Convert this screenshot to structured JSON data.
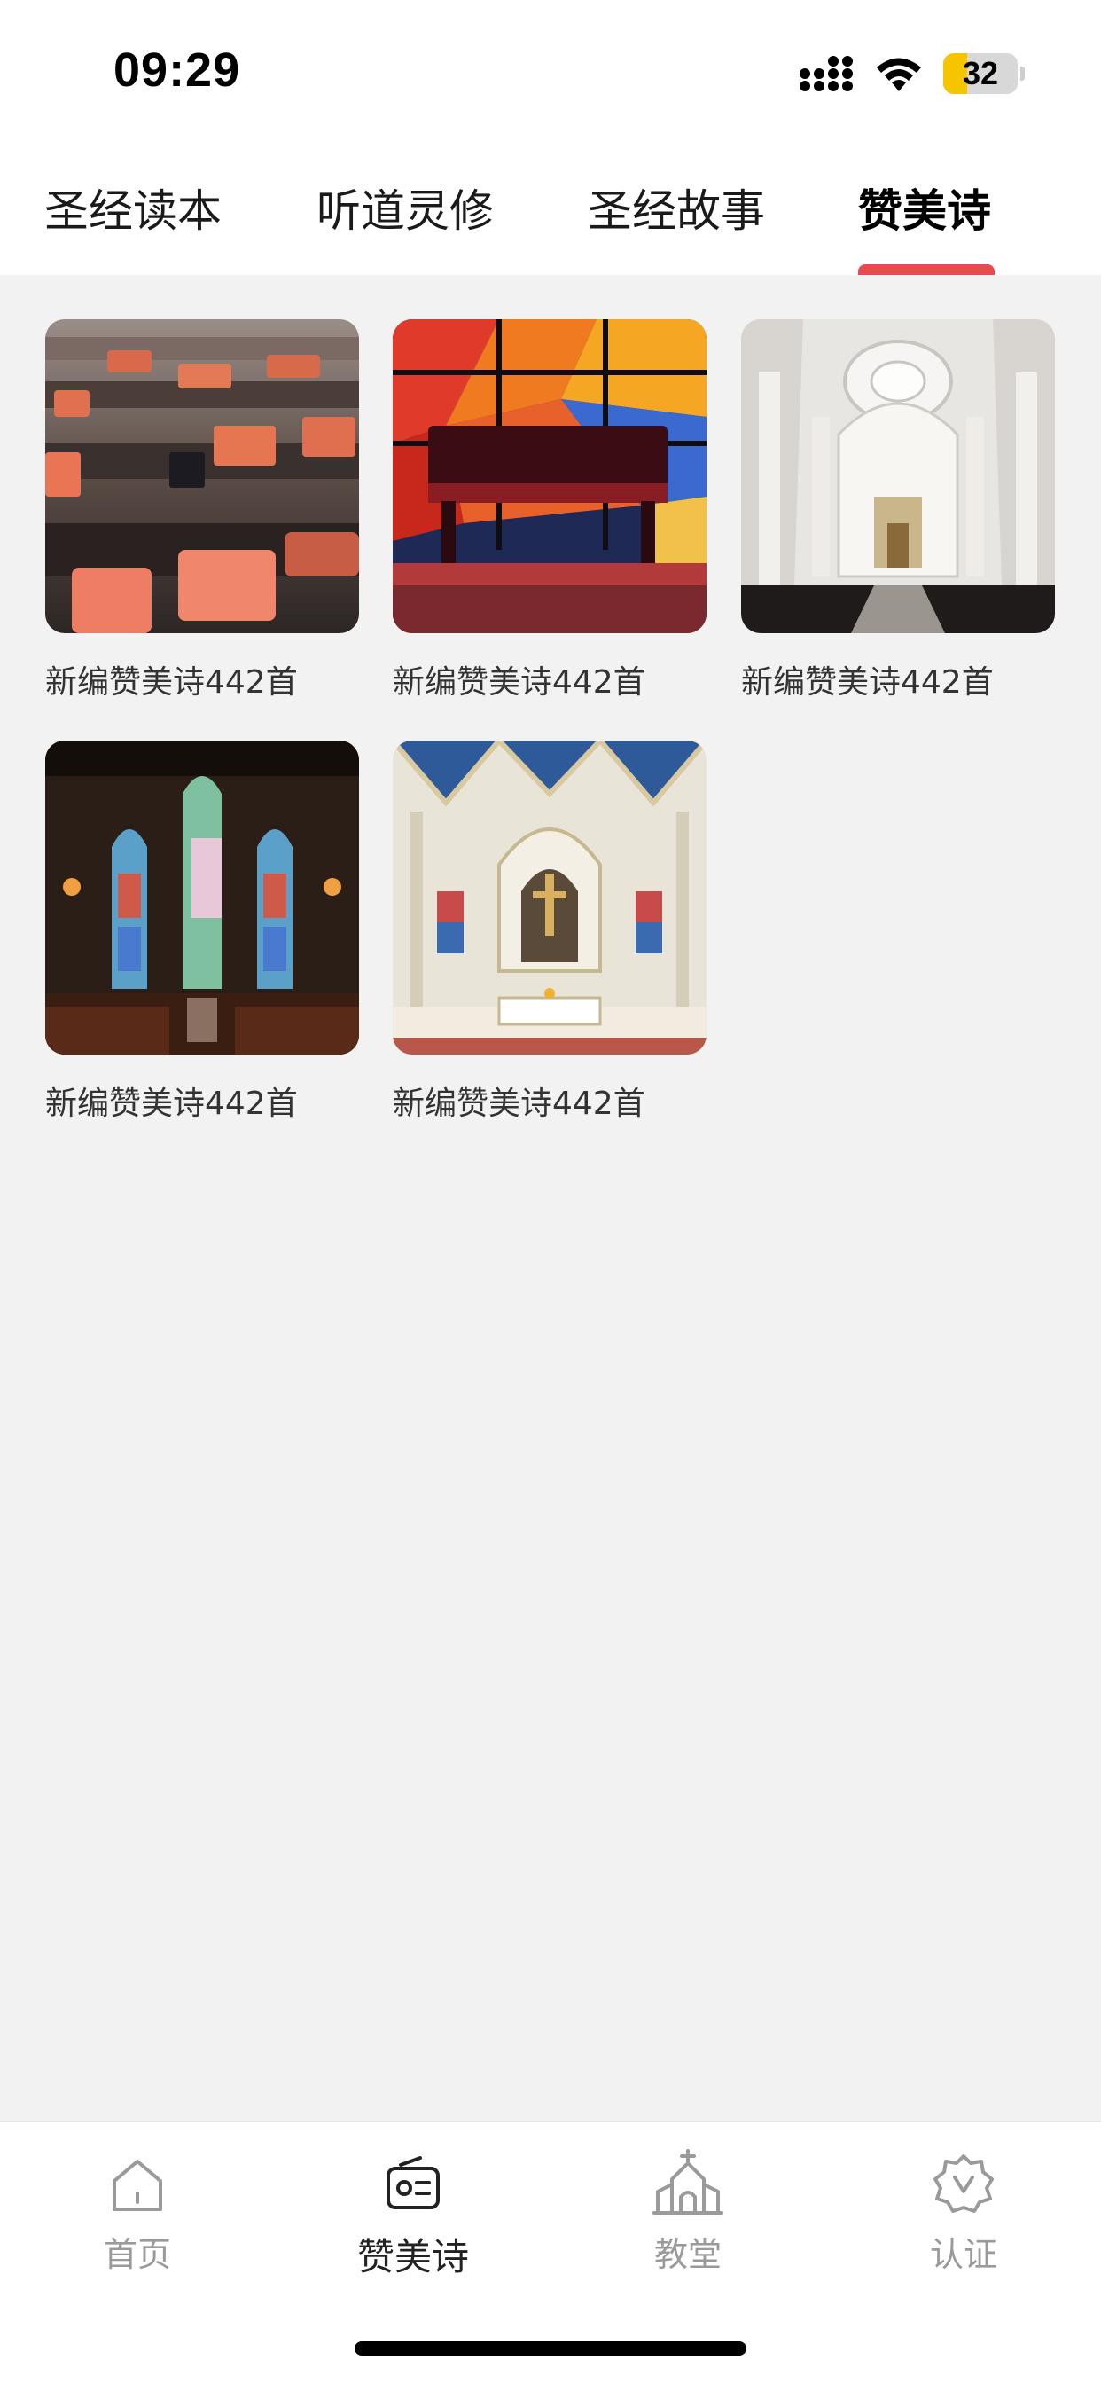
{
  "status_bar": {
    "time": "09:29",
    "battery": "32",
    "battery_color": "#f7c400",
    "icons": [
      "signal-icon",
      "wifi-icon",
      "battery-icon"
    ]
  },
  "top_tabs": [
    {
      "label": "圣经读本",
      "active": false
    },
    {
      "label": "听道灵修",
      "active": false
    },
    {
      "label": "圣经故事",
      "active": false
    },
    {
      "label": "赞美诗",
      "active": true
    }
  ],
  "accent_color": "#e84a4f",
  "items": [
    {
      "title": "新编赞美诗442首",
      "image": "church-pews-with-red-hymnals"
    },
    {
      "title": "新编赞美诗442首",
      "image": "stained-glass-and-bench"
    },
    {
      "title": "新编赞美诗442首",
      "image": "white-cathedral-interior"
    },
    {
      "title": "新编赞美诗442首",
      "image": "church-stained-glass-windows"
    },
    {
      "title": "新编赞美诗442首",
      "image": "gothic-altar-interior"
    }
  ],
  "bottom_nav": [
    {
      "label": "首页",
      "icon": "home-icon",
      "active": false
    },
    {
      "label": "赞美诗",
      "icon": "radio-icon",
      "active": true
    },
    {
      "label": "教堂",
      "icon": "church-icon",
      "active": false
    },
    {
      "label": "认证",
      "icon": "verified-badge-icon",
      "active": false
    }
  ]
}
